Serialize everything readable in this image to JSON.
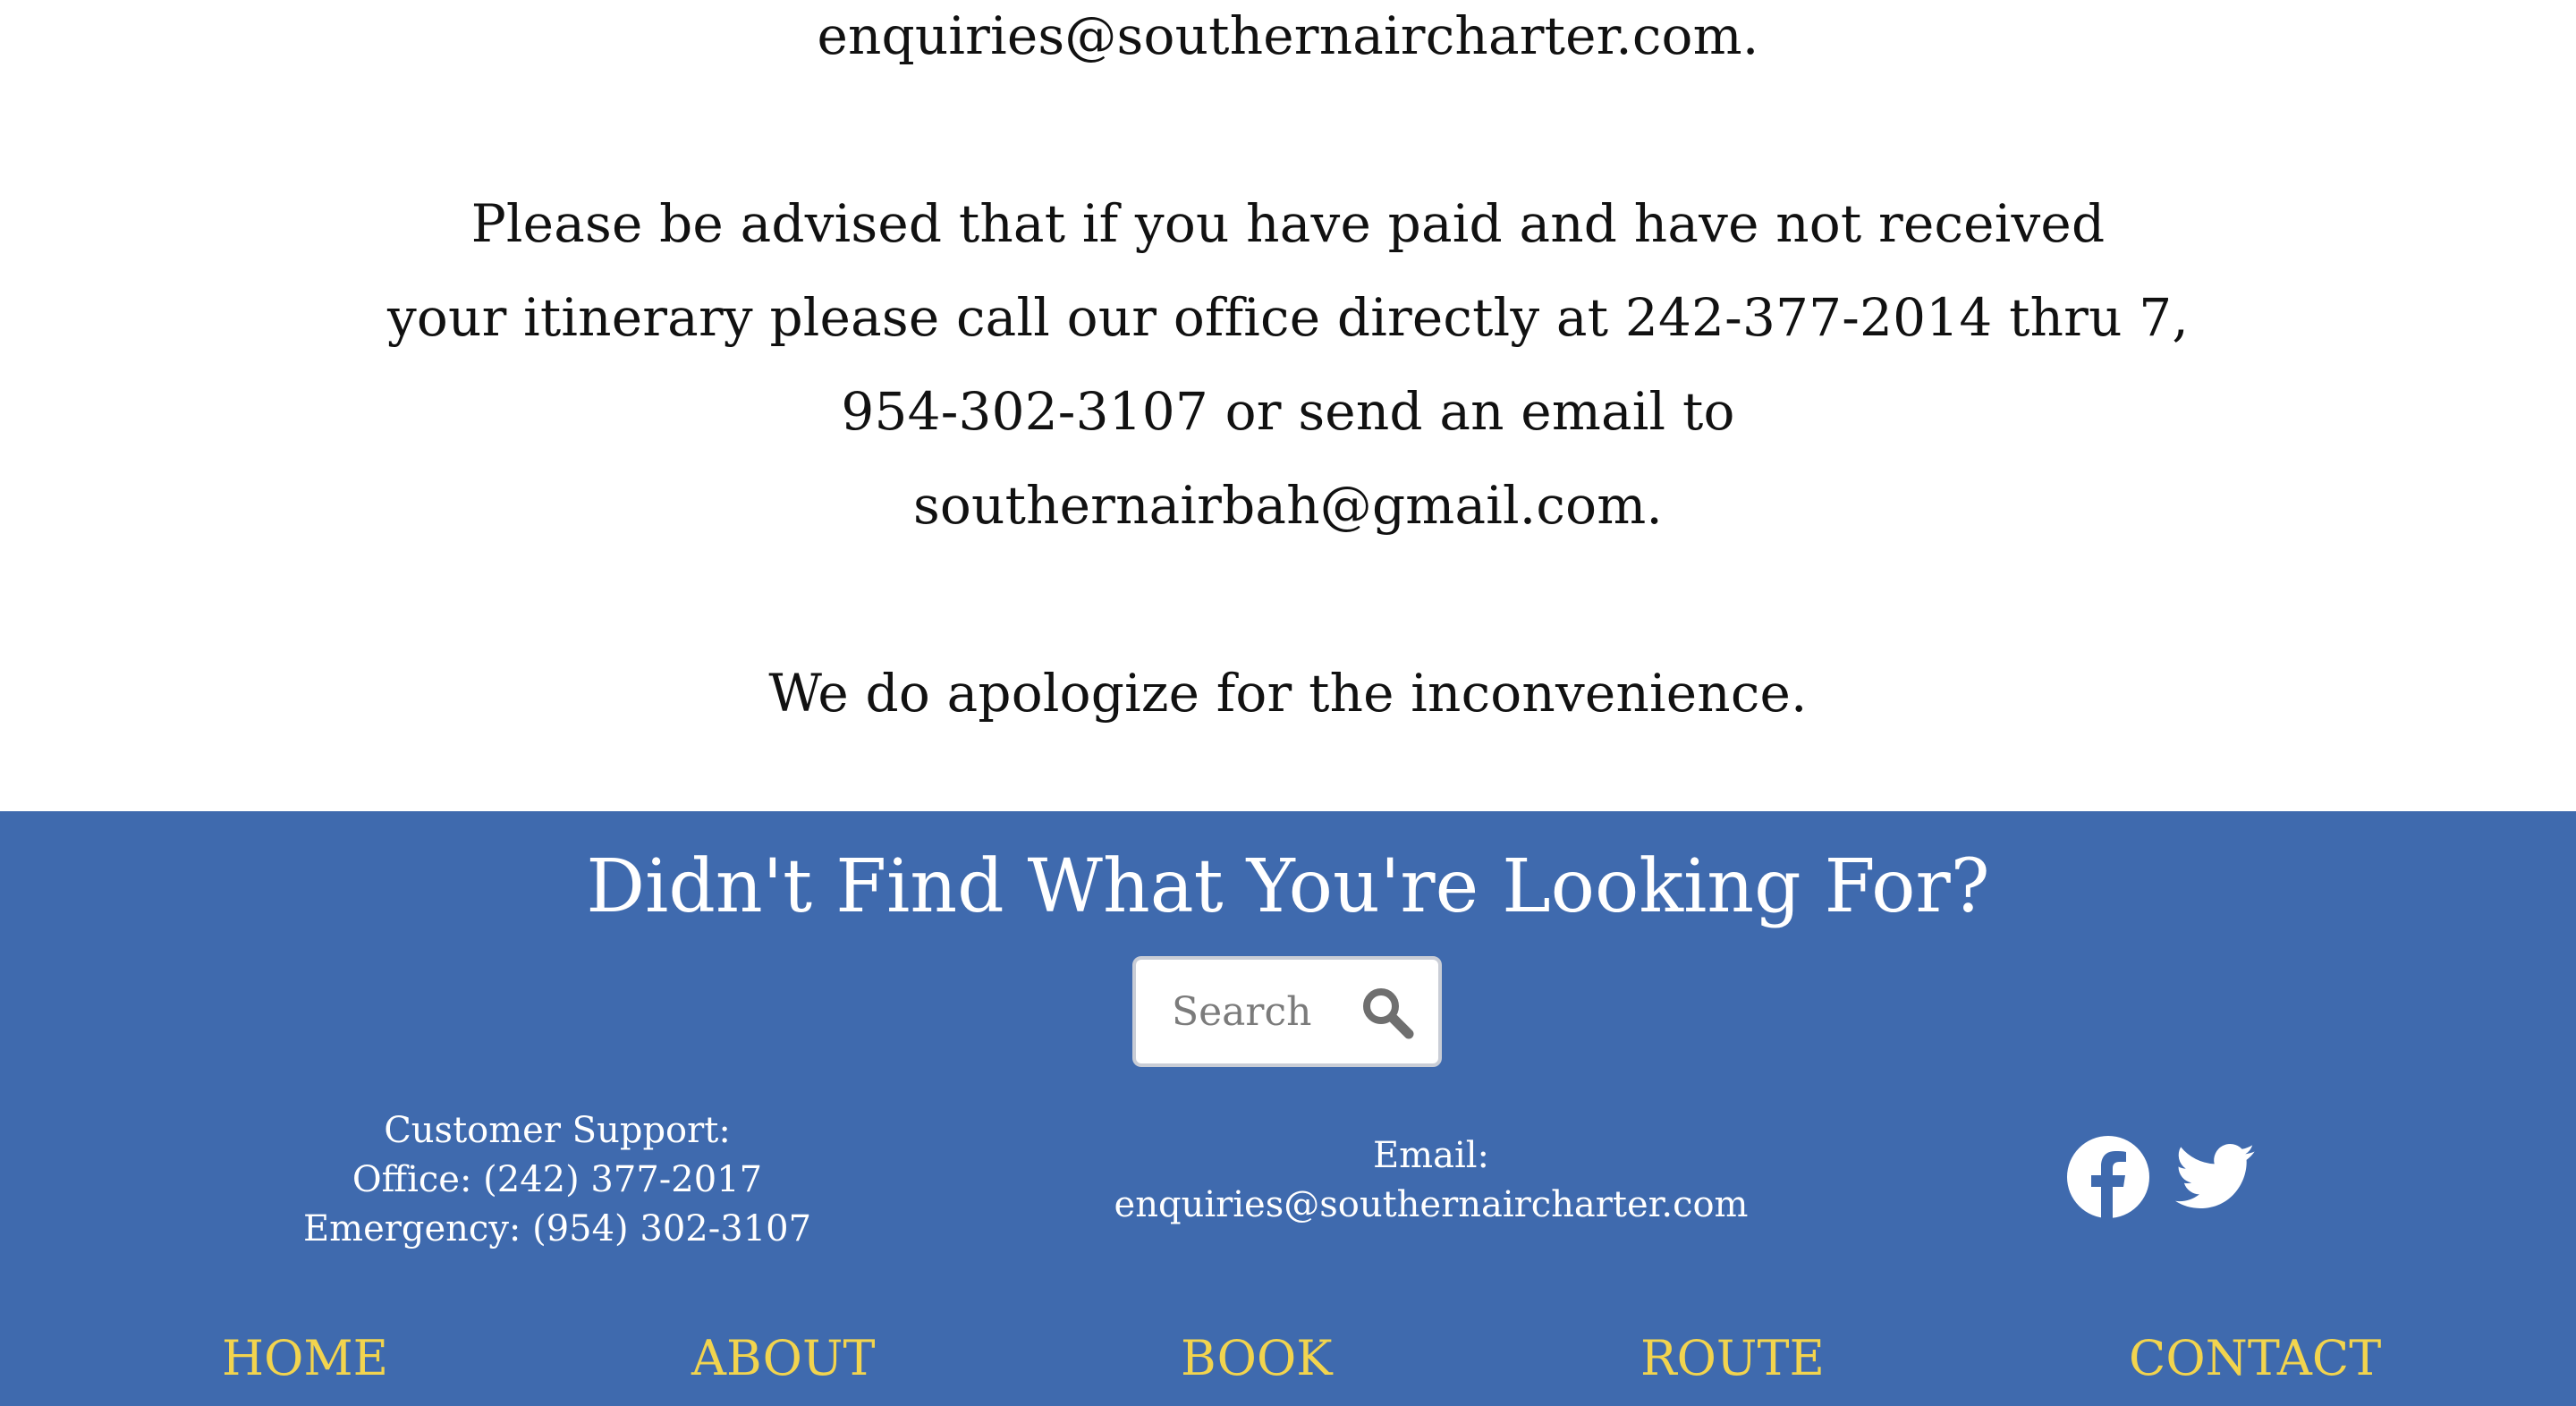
{
  "notice": {
    "lines": [
      "enquiries@southernaircharter.com.",
      "Please be advised that if you have paid and have not received",
      "your itinerary please call our office directly at 242-377-2014 thru 7,",
      "954-302-3107 or send an email to",
      "southernairbah@gmail.com.",
      "We do apologize for the inconvenience."
    ]
  },
  "footer": {
    "heading": "Didn't Find What You're Looking For?",
    "search": {
      "placeholder": "Search",
      "icon": "search-icon"
    },
    "support": {
      "title": "Customer Support:",
      "office": "Office: (242) 377-2017",
      "emergency": "Emergency: (954) 302-3107"
    },
    "email": {
      "label": "Email:",
      "address": "enquiries@southernaircharter.com"
    },
    "social": {
      "facebook_icon": "facebook-icon",
      "twitter_icon": "twitter-icon"
    },
    "nav": {
      "home": "HOME",
      "about": "ABOUT",
      "book": "BOOK",
      "route": "ROUTE",
      "contact": "CONTACT"
    }
  },
  "colors": {
    "footer_background": "#3f6aae",
    "nav_link": "#f2d44e",
    "footer_text": "#ffffff",
    "body_text": "#111111"
  }
}
